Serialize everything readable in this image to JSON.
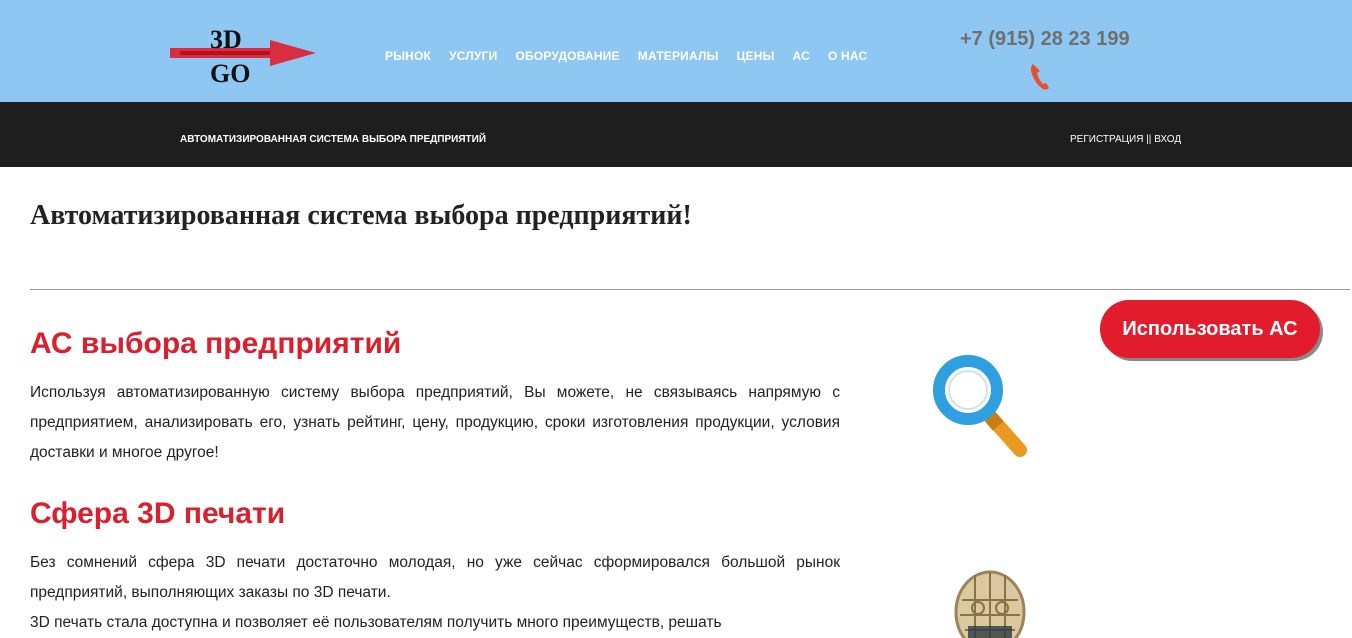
{
  "header": {
    "logo_text_top": "3D",
    "logo_text_bottom": "GO",
    "nav": [
      "РЫНОК",
      "УСЛУГИ",
      "ОБОРУДОВАНИЕ",
      "МАТЕРИАЛЫ",
      "ЦЕНЫ",
      "АС",
      "О НАС"
    ],
    "phone": "+7 (915) 28 23 199",
    "phone_icon": "phone-icon"
  },
  "subbar": {
    "title": "АВТОМАТИЗИРОВАННАЯ СИСТЕМА ВЫБОРА ПРЕДПРИЯТИЙ",
    "register": "РЕГИСТРАЦИЯ",
    "separator": "||",
    "login": "ВХОД"
  },
  "main": {
    "heading_bold": "Автоматизированная система",
    "heading_rest": " выбора предприятий!",
    "use_button": "Использовать АС",
    "sections": [
      {
        "title": "АС выбора предприятий",
        "paragraphs": [
          "Используя автоматизированную систему выбора предприятий, Вы можете, не связываясь напрямую с предприятием, анализировать его, узнать рейтинг, цену, продукцию, сроки изготовления продукции, условия доставки и многое другое!"
        ]
      },
      {
        "title": "Сфера 3D печати",
        "paragraphs": [
          "Без сомнений сфера 3D печати достаточно молодая, но уже сейчас сформировался большой рынок предприятий, выполняющих заказы по 3D печати.",
          "3D печать стала доступна и позволяет её пользователям получить много преимуществ, решать"
        ]
      }
    ]
  },
  "colors": {
    "header_bg": "#8ec8f2",
    "subbar_bg": "#1e1e1e",
    "accent_red": "#e31c2d",
    "phone_gray": "#6f6f6f"
  }
}
